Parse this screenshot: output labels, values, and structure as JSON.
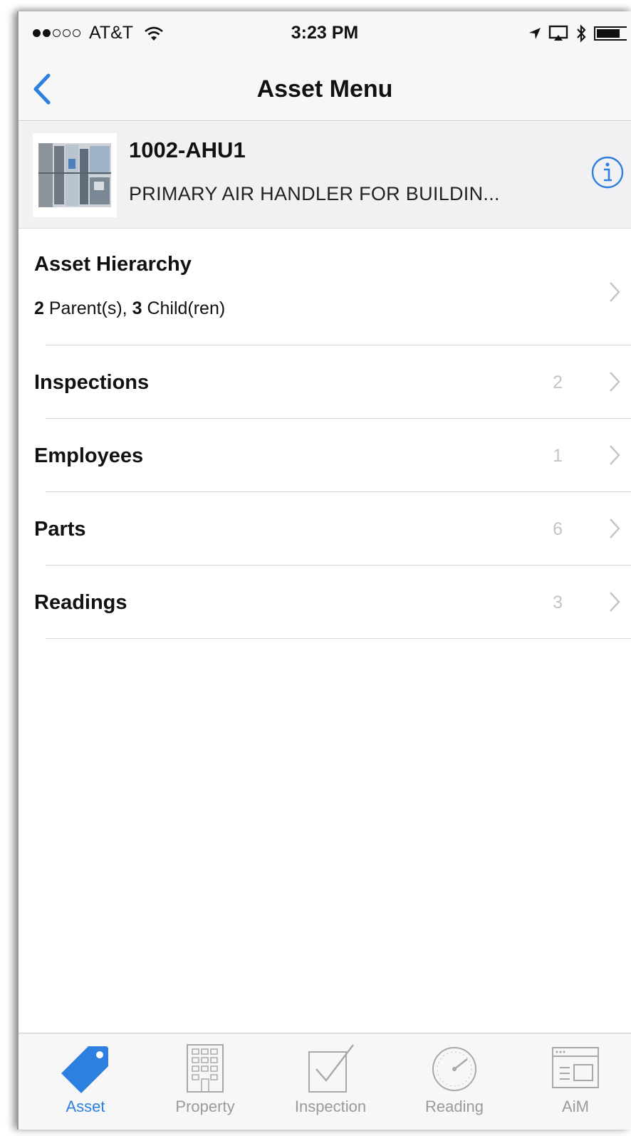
{
  "status_bar": {
    "carrier": "AT&T",
    "time": "3:23 PM"
  },
  "nav": {
    "title": "Asset Menu"
  },
  "asset": {
    "id": "1002-AHU1",
    "description": "PRIMARY AIR HANDLER FOR BUILDIN..."
  },
  "menu": {
    "hierarchy": {
      "title": "Asset Hierarchy",
      "parents_count": "2",
      "parents_label": "Parent(s),",
      "children_count": "3",
      "children_label": "Child(ren)"
    },
    "items": [
      {
        "label": "Inspections",
        "count": "2"
      },
      {
        "label": "Employees",
        "count": "1"
      },
      {
        "label": "Parts",
        "count": "6"
      },
      {
        "label": "Readings",
        "count": "3"
      }
    ]
  },
  "tab_bar": {
    "tabs": [
      {
        "label": "Asset",
        "icon": "tag-icon",
        "active": true
      },
      {
        "label": "Property",
        "icon": "building-icon",
        "active": false
      },
      {
        "label": "Inspection",
        "icon": "checkbox-icon",
        "active": false
      },
      {
        "label": "Reading",
        "icon": "gauge-icon",
        "active": false
      },
      {
        "label": "AiM",
        "icon": "window-icon",
        "active": false
      }
    ]
  },
  "colors": {
    "accent": "#2d7fe0",
    "inactive": "#9a9a9a",
    "count": "#c4c4c4"
  }
}
